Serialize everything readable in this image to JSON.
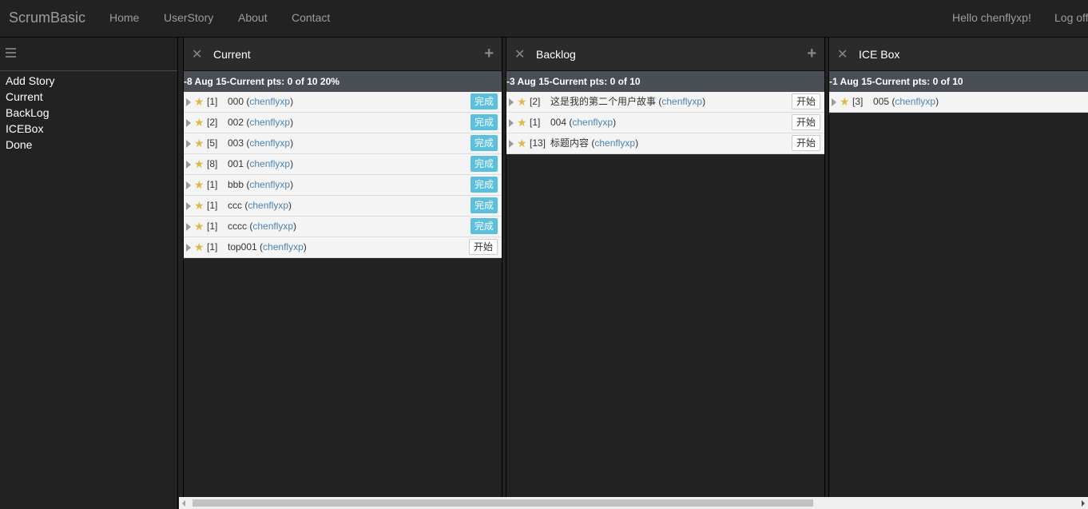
{
  "navbar": {
    "brand": "ScrumBasic",
    "links": [
      "Home",
      "UserStory",
      "About",
      "Contact"
    ],
    "greeting": "Hello chenflyxp!",
    "logoff": "Log off"
  },
  "sidebar": {
    "menu_icon": "hamburger-icon",
    "items": [
      "Add Story",
      "Current",
      "BackLog",
      "ICEBox",
      "Done"
    ]
  },
  "panels": [
    {
      "title": "Current",
      "iteration": "-8 Aug 15-Current pts: 0 of 10 20%",
      "stories": [
        {
          "points": "[1]",
          "title": "000",
          "owner": "chenflyxp",
          "action": "完成",
          "done": true
        },
        {
          "points": "[2]",
          "title": "002",
          "owner": "chenflyxp",
          "action": "完成",
          "done": true
        },
        {
          "points": "[5]",
          "title": "003",
          "owner": "chenflyxp",
          "action": "完成",
          "done": true
        },
        {
          "points": "[8]",
          "title": "001",
          "owner": "chenflyxp",
          "action": "完成",
          "done": true
        },
        {
          "points": "[1]",
          "title": "bbb",
          "owner": "chenflyxp",
          "action": "完成",
          "done": true
        },
        {
          "points": "[1]",
          "title": "ccc",
          "owner": "chenflyxp",
          "action": "完成",
          "done": true
        },
        {
          "points": "[1]",
          "title": "cccc",
          "owner": "chenflyxp",
          "action": "完成",
          "done": true
        },
        {
          "points": "[1]",
          "title": "top001",
          "owner": "chenflyxp",
          "action": "开始",
          "done": false
        }
      ]
    },
    {
      "title": "Backlog",
      "iteration": "-3 Aug 15-Current pts: 0 of 10",
      "stories": [
        {
          "points": "[2]",
          "title": "这是我的第二个用户故事",
          "owner": "chenflyxp",
          "action": "开始",
          "done": false
        },
        {
          "points": "[1]",
          "title": "004",
          "owner": "chenflyxp",
          "action": "开始",
          "done": false
        },
        {
          "points": "[13]",
          "title": "标题内容",
          "owner": "chenflyxp",
          "action": "开始",
          "done": false
        }
      ]
    },
    {
      "title": "ICE Box",
      "iteration": "-1 Aug 15-Current pts: 0 of 10",
      "stories": [
        {
          "points": "[3]",
          "title": "005",
          "owner": "chenflyxp",
          "action": "",
          "done": false
        }
      ]
    }
  ]
}
